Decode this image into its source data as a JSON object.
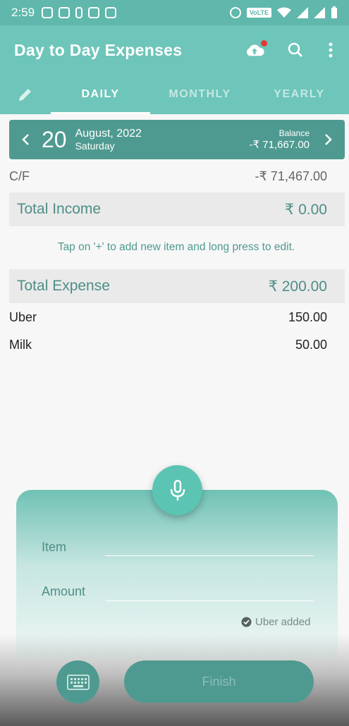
{
  "status_bar": {
    "time": "2:59",
    "volte": "VoLTE"
  },
  "app_bar": {
    "title": "Day to Day Expenses",
    "icons": [
      "cloud-upload-icon",
      "search-icon",
      "more-vert-icon"
    ]
  },
  "tabs": [
    {
      "label": "DAILY",
      "active": true
    },
    {
      "label": "MONTHLY",
      "active": false
    },
    {
      "label": "YEARLY",
      "active": false
    }
  ],
  "date_bar": {
    "day": "20",
    "month_year": "August, 2022",
    "weekday": "Saturday",
    "balance_label": "Balance",
    "balance_value": "-₹ 71,667.00"
  },
  "cf": {
    "label": "C/F",
    "value": "-₹ 71,467.00"
  },
  "income": {
    "label": "Total Income",
    "value": "₹ 0.00"
  },
  "hint": "Tap on '+' to add new item and long press to edit.",
  "expense": {
    "label": "Total Expense",
    "value": "₹ 200.00"
  },
  "items": [
    {
      "name": "Uber",
      "amount": "150.00"
    },
    {
      "name": "Milk",
      "amount": "50.00"
    }
  ],
  "form": {
    "item_label": "Item",
    "amount_label": "Amount",
    "status_note": "Uber added",
    "finish_label": "Finish"
  },
  "colors": {
    "primary": "#6ec5b9",
    "dark": "#4f9a90",
    "accent": "#5cc4b2",
    "badge": "#e53935"
  }
}
